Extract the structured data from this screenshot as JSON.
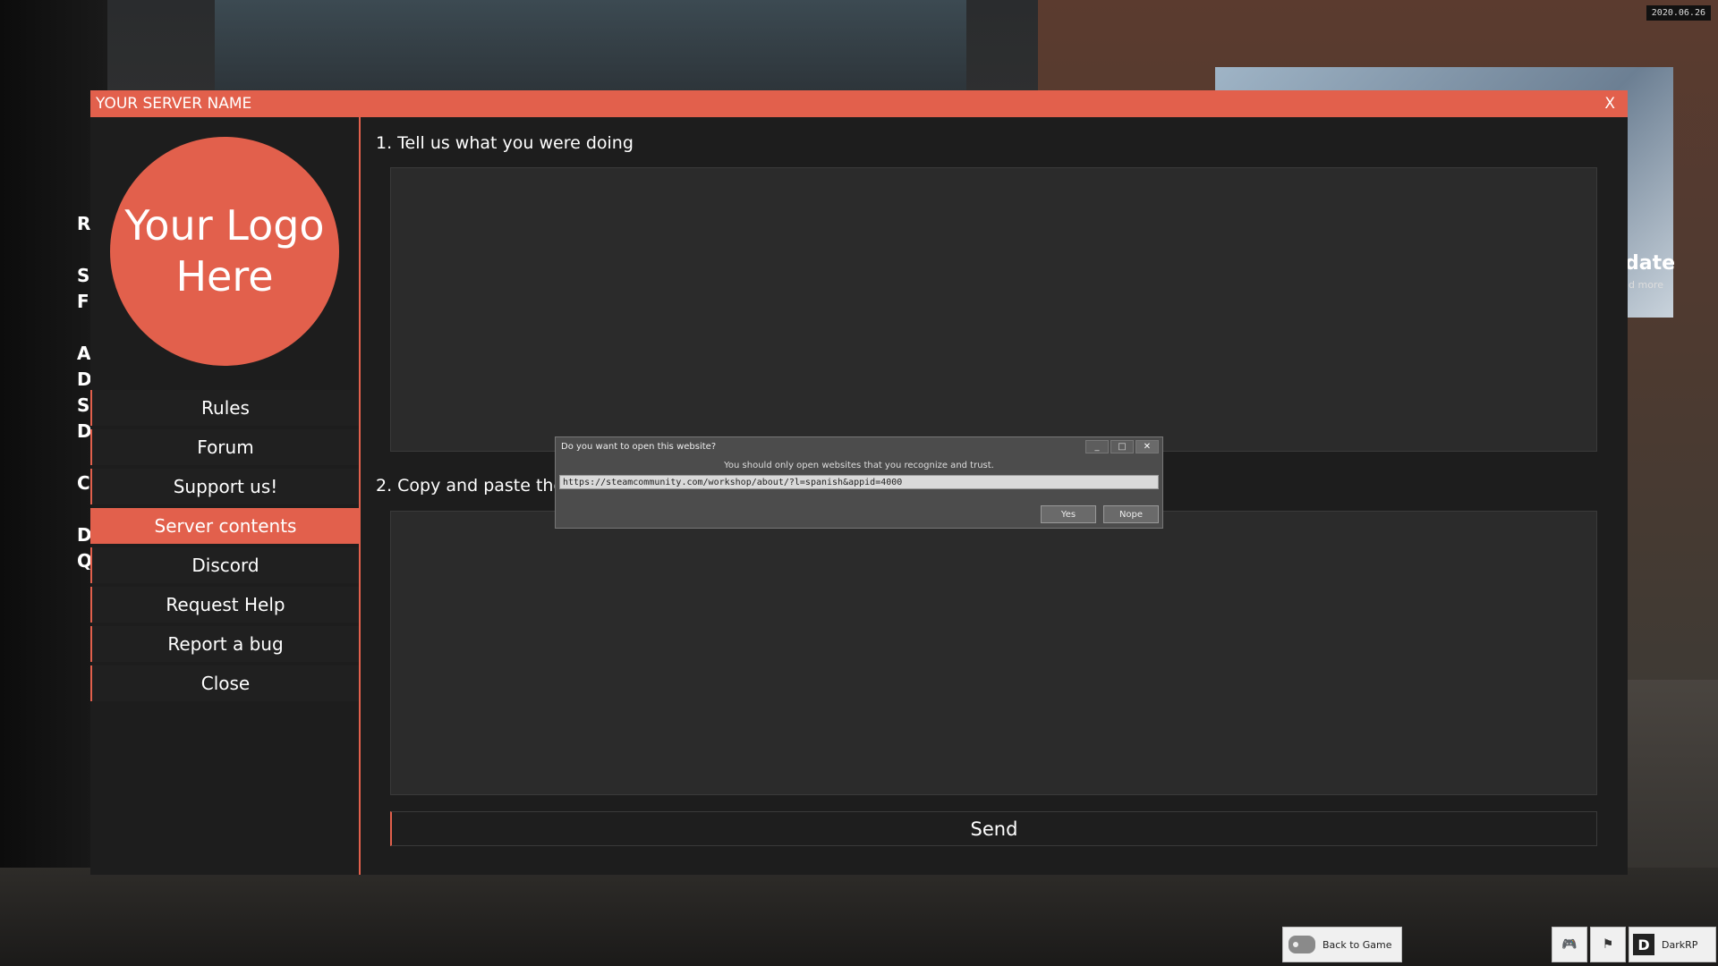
{
  "background": {
    "date_badge": "2020.06.26",
    "left_letters": [
      "R",
      "",
      "S",
      "F",
      "",
      "A",
      "D",
      "S",
      "D",
      "",
      "C",
      "",
      "D",
      "Q"
    ],
    "banner_text": "date",
    "banner_sub": "d more"
  },
  "window": {
    "title": "YOUR SERVER NAME",
    "close_label": "X",
    "accent_color": "#e2604c",
    "logo_text": "Your Logo Here"
  },
  "sidebar": {
    "items": [
      {
        "label": "Rules",
        "active": false
      },
      {
        "label": "Forum",
        "active": false
      },
      {
        "label": "Support us!",
        "active": false
      },
      {
        "label": "Server contents",
        "active": true
      },
      {
        "label": "Discord",
        "active": false
      },
      {
        "label": "Request Help",
        "active": false
      },
      {
        "label": "Report a bug",
        "active": false
      },
      {
        "label": "Close",
        "active": false
      }
    ]
  },
  "form": {
    "label1": "1. Tell us what you were doing",
    "label2": "2. Copy and paste the e",
    "send_label": "Send"
  },
  "dialog": {
    "title": "Do you want to open this website?",
    "message": "You should only open websites that you recognize and trust.",
    "url": "https://steamcommunity.com/workshop/about/?l=spanish&appid=4000",
    "yes_label": "Yes",
    "no_label": "Nope",
    "minimize": "_",
    "maximize": "□",
    "close": "✕"
  },
  "bottombar": {
    "back_label": "Back to Game",
    "gamemode_label": "DarkRP",
    "gamemode_icon_letter": "D",
    "icons": [
      "gamepad-icon",
      "flag-icon"
    ]
  }
}
